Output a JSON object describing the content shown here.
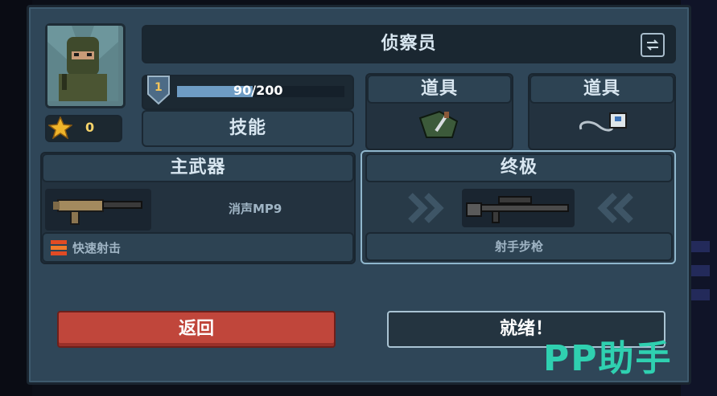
{
  "character": {
    "name": "侦察员",
    "stars": "0",
    "level": "1",
    "xp": "90/200",
    "xp_progress": 0.45
  },
  "slots": {
    "skill_label": "技能",
    "item1_label": "道具",
    "item2_label": "道具"
  },
  "primary": {
    "header": "主武器",
    "weapon_name": "消声MP9",
    "perk": "快速射击"
  },
  "ultimate": {
    "header": "终极",
    "weapon_name": "射手步枪"
  },
  "buttons": {
    "back": "返回",
    "ready": "就绪！"
  },
  "watermark": "PP助手",
  "colors": {
    "back_button": "#c0463b",
    "panel": "#2f4658",
    "watermark": "#2fd0b0"
  }
}
